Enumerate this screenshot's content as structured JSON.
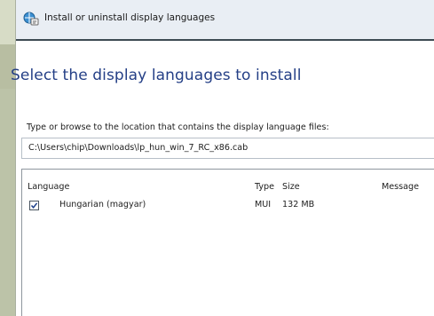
{
  "window": {
    "title": "Install or uninstall display languages",
    "heading": "Select the display languages to install"
  },
  "instruction": "Type or browse to the location that contains the display language files:",
  "path_field": {
    "value": "C:\\Users\\chip\\Downloads\\lp_hun_win_7_RC_x86.cab"
  },
  "table": {
    "columns": [
      "Language",
      "Type",
      "Size",
      "Message"
    ],
    "rows": [
      {
        "checked": true,
        "language": "Hungarian (magyar)",
        "type": "MUI",
        "size": "132 MB",
        "message": ""
      }
    ]
  },
  "colors": {
    "heading": "#243f86",
    "titlebar": "#e9eef4",
    "background": "#c9cdb8"
  }
}
